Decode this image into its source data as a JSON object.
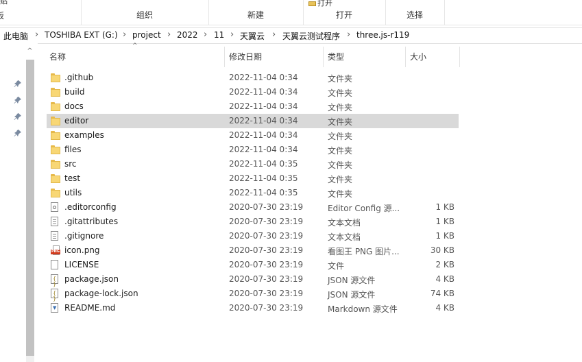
{
  "ribbon": {
    "groups": [
      {
        "label": "组织"
      },
      {
        "label": "新建"
      },
      {
        "label": "打开"
      },
      {
        "label": "选择"
      }
    ],
    "partial_left_top": "贴",
    "partial_left_bottom": "板",
    "partial_open_top": "打开"
  },
  "address": {
    "crumbs": [
      "此电脑",
      "TOSHIBA EXT (G:)",
      "project",
      "2022",
      "11",
      "天翼云",
      "天翼云测试程序",
      "three.js-r119"
    ],
    "separator": "›"
  },
  "columns": {
    "name": "名称",
    "modified": "修改日期",
    "type": "类型",
    "size": "大小"
  },
  "files": [
    {
      "name": ".github",
      "modified": "2022-11-04 0:34",
      "type": "文件夹",
      "size": "",
      "icon": "folder-icon"
    },
    {
      "name": "build",
      "modified": "2022-11-04 0:34",
      "type": "文件夹",
      "size": "",
      "icon": "folder-icon"
    },
    {
      "name": "docs",
      "modified": "2022-11-04 0:34",
      "type": "文件夹",
      "size": "",
      "icon": "folder-icon"
    },
    {
      "name": "editor",
      "modified": "2022-11-04 0:34",
      "type": "文件夹",
      "size": "",
      "icon": "folder-icon",
      "selected": true
    },
    {
      "name": "examples",
      "modified": "2022-11-04 0:34",
      "type": "文件夹",
      "size": "",
      "icon": "folder-icon"
    },
    {
      "name": "files",
      "modified": "2022-11-04 0:34",
      "type": "文件夹",
      "size": "",
      "icon": "folder-icon"
    },
    {
      "name": "src",
      "modified": "2022-11-04 0:35",
      "type": "文件夹",
      "size": "",
      "icon": "folder-icon"
    },
    {
      "name": "test",
      "modified": "2022-11-04 0:35",
      "type": "文件夹",
      "size": "",
      "icon": "folder-icon"
    },
    {
      "name": "utils",
      "modified": "2022-11-04 0:35",
      "type": "文件夹",
      "size": "",
      "icon": "folder-icon"
    },
    {
      "name": ".editorconfig",
      "modified": "2020-07-30 23:19",
      "type": "Editor Config 源...",
      "size": "1 KB",
      "icon": "config-file-icon"
    },
    {
      "name": ".gitattributes",
      "modified": "2020-07-30 23:19",
      "type": "文本文档",
      "size": "1 KB",
      "icon": "text-file-icon"
    },
    {
      "name": ".gitignore",
      "modified": "2020-07-30 23:19",
      "type": "文本文档",
      "size": "1 KB",
      "icon": "text-file-icon"
    },
    {
      "name": "icon.png",
      "modified": "2020-07-30 23:19",
      "type": "看图王 PNG 图片...",
      "size": "30 KB",
      "icon": "png-file-icon"
    },
    {
      "name": "LICENSE",
      "modified": "2020-07-30 23:19",
      "type": "文件",
      "size": "2 KB",
      "icon": "blank-file-icon"
    },
    {
      "name": "package.json",
      "modified": "2020-07-30 23:19",
      "type": "JSON 源文件",
      "size": "4 KB",
      "icon": "json-file-icon"
    },
    {
      "name": "package-lock.json",
      "modified": "2020-07-30 23:19",
      "type": "JSON 源文件",
      "size": "74 KB",
      "icon": "json-file-icon"
    },
    {
      "name": "README.md",
      "modified": "2020-07-30 23:19",
      "type": "Markdown 源文件",
      "size": "4 KB",
      "icon": "markdown-file-icon"
    }
  ],
  "nav": {
    "scroll_up": "^",
    "sort_indicator": "^",
    "pins": [
      "pin-icon",
      "pin-icon",
      "pin-icon",
      "pin-icon"
    ]
  },
  "colors": {
    "selected_row": "#d9d9d9",
    "folder": "#f8d775",
    "scrollbar_thumb": "#c2c2c2"
  }
}
